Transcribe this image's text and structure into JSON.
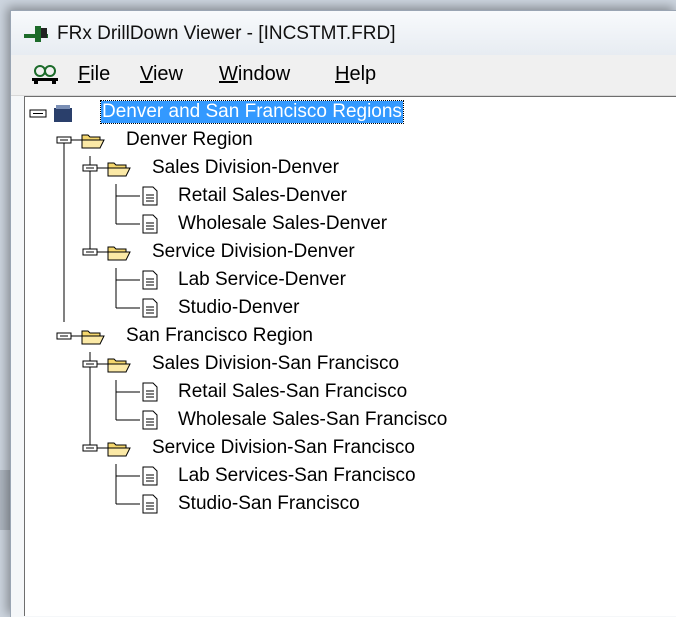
{
  "window": {
    "title": "FRx DrillDown Viewer - [INCSTMT.FRD]"
  },
  "menu": [
    {
      "key": "file",
      "accel": "F",
      "rest": "ile"
    },
    {
      "key": "view",
      "accel": "V",
      "rest": "iew"
    },
    {
      "key": "window",
      "accel": "W",
      "rest": "indow"
    },
    {
      "key": "help",
      "accel": "H",
      "rest": "elp"
    }
  ],
  "tree": {
    "root": "Denver and San Francisco Regions",
    "denver_region": "Denver Region",
    "sales_denver": "Sales Division-Denver",
    "retail_denver": "Retail Sales-Denver",
    "wholesale_denver": "Wholesale Sales-Denver",
    "service_denver": "Service Division-Denver",
    "lab_denver": "Lab Service-Denver",
    "studio_denver": "Studio-Denver",
    "sf_region": "San Francisco Region",
    "sales_sf": "Sales Division-San Francisco",
    "retail_sf": "Retail Sales-San Francisco",
    "wholesale_sf": "Wholesale Sales-San Francisco",
    "service_sf": "Service Division-San Francisco",
    "lab_sf": "Lab Services-San Francisco",
    "studio_sf": "Studio-San Francisco"
  },
  "colors": {
    "selection": "#3399ff",
    "folder": "#f5d76e"
  },
  "icons": [
    "frx-app-icon",
    "drilldown-icon",
    "report-tree-icon",
    "folder-open-icon",
    "document-icon",
    "collapse-icon"
  ]
}
